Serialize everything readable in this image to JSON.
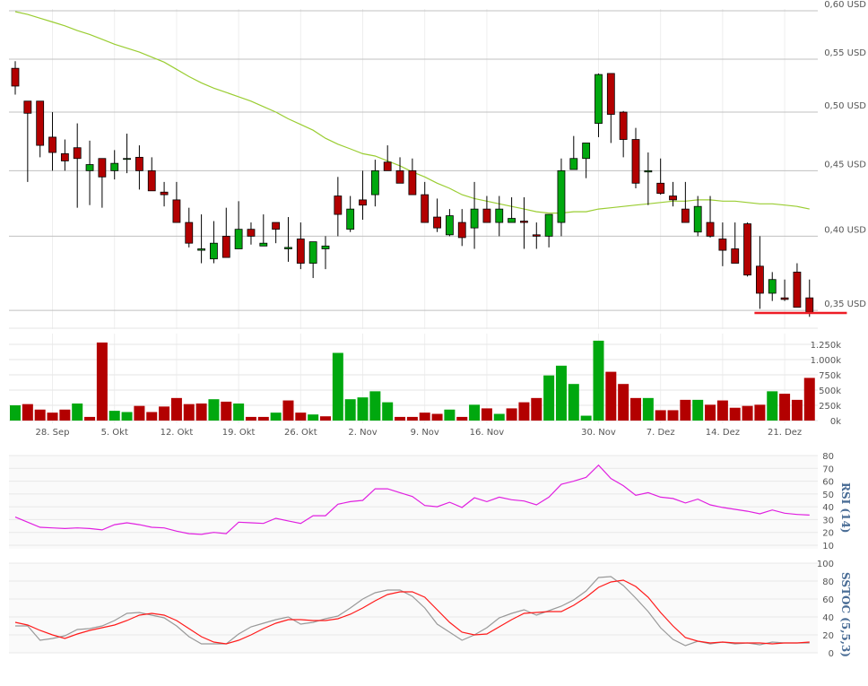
{
  "chart_data": [
    {
      "type": "candlestick",
      "panel": "price",
      "y_scale": "log",
      "ylim": [
        0.345,
        0.6
      ],
      "y_ticks": [
        {
          "value": 0.6,
          "label": "0,60 USD"
        },
        {
          "value": 0.55,
          "label": "0,55 USD"
        },
        {
          "value": 0.5,
          "label": "0,50 USD"
        },
        {
          "value": 0.45,
          "label": "0,45 USD"
        },
        {
          "value": 0.4,
          "label": "0,40 USD"
        },
        {
          "value": 0.35,
          "label": "0,35 USD"
        }
      ],
      "grid": true,
      "up_color": "#00a80f",
      "down_color": "#b30000",
      "ma_color": "#9acd32",
      "support_color": "#ee1c25",
      "support_level": 0.349,
      "support_range": [
        60,
        66
      ],
      "ohlc": [
        [
          0.541,
          0.548,
          0.516,
          0.524
        ],
        [
          0.51,
          0.51,
          0.441,
          0.499
        ],
        [
          0.51,
          0.51,
          0.461,
          0.471
        ],
        [
          0.478,
          0.5,
          0.45,
          0.465
        ],
        [
          0.464,
          0.476,
          0.45,
          0.458
        ],
        [
          0.469,
          0.49,
          0.421,
          0.46
        ],
        [
          0.45,
          0.475,
          0.423,
          0.455
        ],
        [
          0.46,
          0.46,
          0.421,
          0.445
        ],
        [
          0.45,
          0.467,
          0.443,
          0.456
        ],
        [
          0.46,
          0.481,
          0.448,
          0.46
        ],
        [
          0.461,
          0.471,
          0.435,
          0.45
        ],
        [
          0.45,
          0.461,
          0.434,
          0.434
        ],
        [
          0.433,
          0.441,
          0.422,
          0.431
        ],
        [
          0.427,
          0.441,
          0.41,
          0.41
        ],
        [
          0.41,
          0.421,
          0.392,
          0.395
        ],
        [
          0.39,
          0.416,
          0.381,
          0.391
        ],
        [
          0.384,
          0.411,
          0.381,
          0.395
        ],
        [
          0.4,
          0.421,
          0.385,
          0.385
        ],
        [
          0.391,
          0.426,
          0.391,
          0.405
        ],
        [
          0.405,
          0.41,
          0.394,
          0.4
        ],
        [
          0.393,
          0.416,
          0.393,
          0.395
        ],
        [
          0.41,
          0.41,
          0.395,
          0.405
        ],
        [
          0.391,
          0.414,
          0.382,
          0.392
        ],
        [
          0.398,
          0.41,
          0.377,
          0.381
        ],
        [
          0.381,
          0.396,
          0.371,
          0.396
        ],
        [
          0.391,
          0.4,
          0.377,
          0.393
        ],
        [
          0.43,
          0.445,
          0.4,
          0.416
        ],
        [
          0.405,
          0.43,
          0.403,
          0.42
        ],
        [
          0.427,
          0.45,
          0.412,
          0.423
        ],
        [
          0.431,
          0.459,
          0.422,
          0.45
        ],
        [
          0.457,
          0.471,
          0.45,
          0.45
        ],
        [
          0.45,
          0.461,
          0.44,
          0.44
        ],
        [
          0.45,
          0.46,
          0.431,
          0.431
        ],
        [
          0.431,
          0.441,
          0.41,
          0.41
        ],
        [
          0.414,
          0.428,
          0.403,
          0.406
        ],
        [
          0.401,
          0.42,
          0.4,
          0.415
        ],
        [
          0.41,
          0.42,
          0.393,
          0.399
        ],
        [
          0.406,
          0.441,
          0.391,
          0.42
        ],
        [
          0.42,
          0.43,
          0.41,
          0.41
        ],
        [
          0.41,
          0.43,
          0.4,
          0.42
        ],
        [
          0.41,
          0.429,
          0.41,
          0.413
        ],
        [
          0.411,
          0.429,
          0.391,
          0.41
        ],
        [
          0.401,
          0.41,
          0.391,
          0.4
        ],
        [
          0.4,
          0.416,
          0.392,
          0.416
        ],
        [
          0.41,
          0.46,
          0.4,
          0.45
        ],
        [
          0.451,
          0.479,
          0.451,
          0.46
        ],
        [
          0.46,
          0.473,
          0.444,
          0.473
        ],
        [
          0.49,
          0.536,
          0.478,
          0.535
        ],
        [
          0.536,
          0.536,
          0.473,
          0.498
        ],
        [
          0.5,
          0.501,
          0.461,
          0.476
        ],
        [
          0.476,
          0.486,
          0.436,
          0.44
        ],
        [
          0.449,
          0.465,
          0.423,
          0.45
        ],
        [
          0.44,
          0.46,
          0.431,
          0.432
        ],
        [
          0.43,
          0.441,
          0.422,
          0.427
        ],
        [
          0.42,
          0.441,
          0.41,
          0.41
        ],
        [
          0.403,
          0.43,
          0.4,
          0.422
        ],
        [
          0.41,
          0.43,
          0.399,
          0.4
        ],
        [
          0.398,
          0.41,
          0.379,
          0.39
        ],
        [
          0.391,
          0.41,
          0.381,
          0.381
        ],
        [
          0.409,
          0.41,
          0.372,
          0.373
        ],
        [
          0.379,
          0.4,
          0.351,
          0.361
        ],
        [
          0.361,
          0.375,
          0.356,
          0.37
        ],
        [
          0.358,
          0.37,
          0.356,
          0.357
        ],
        [
          0.375,
          0.381,
          0.352,
          0.352
        ],
        [
          0.358,
          0.37,
          0.346,
          0.349
        ]
      ],
      "moving_average": [
        0.599,
        0.596,
        0.592,
        0.588,
        0.584,
        0.579,
        0.575,
        0.57,
        0.565,
        0.561,
        0.557,
        0.552,
        0.547,
        0.54,
        0.533,
        0.527,
        0.522,
        0.518,
        0.514,
        0.51,
        0.505,
        0.5,
        0.494,
        0.489,
        0.484,
        0.477,
        0.472,
        0.468,
        0.464,
        0.462,
        0.458,
        0.454,
        0.449,
        0.445,
        0.44,
        0.436,
        0.431,
        0.428,
        0.426,
        0.424,
        0.422,
        0.42,
        0.418,
        0.417,
        0.417,
        0.418,
        0.418,
        0.42,
        0.421,
        0.422,
        0.423,
        0.424,
        0.425,
        0.426,
        0.426,
        0.427,
        0.427,
        0.426,
        0.426,
        0.425,
        0.424,
        0.424,
        0.423,
        0.422,
        0.42
      ]
    },
    {
      "type": "bar",
      "panel": "volume",
      "ylim": [
        0,
        1250
      ],
      "y_ticks": [
        {
          "value": 1250,
          "label": "1.250k"
        },
        {
          "value": 1000,
          "label": "1.000k"
        },
        {
          "value": 750,
          "label": "750k"
        },
        {
          "value": 500,
          "label": "500k"
        },
        {
          "value": 250,
          "label": "250k"
        },
        {
          "value": 0,
          "label": "0k"
        }
      ],
      "x_ticks": [
        {
          "index": 3,
          "label": "28. Sep"
        },
        {
          "index": 8,
          "label": "5. Okt"
        },
        {
          "index": 13,
          "label": "12. Okt"
        },
        {
          "index": 18,
          "label": "19. Okt"
        },
        {
          "index": 23,
          "label": "26. Okt"
        },
        {
          "index": 28,
          "label": "2. Nov"
        },
        {
          "index": 33,
          "label": "9. Nov"
        },
        {
          "index": 38,
          "label": "16. Nov"
        },
        {
          "index": 47,
          "label": "30. Nov"
        },
        {
          "index": 52,
          "label": "7. Dez"
        },
        {
          "index": 57,
          "label": "14. Dez"
        },
        {
          "index": 62,
          "label": "21. Dez"
        }
      ],
      "values": [
        250,
        270,
        180,
        130,
        180,
        280,
        60,
        1280,
        160,
        140,
        240,
        140,
        230,
        370,
        270,
        280,
        350,
        310,
        280,
        60,
        60,
        130,
        330,
        130,
        100,
        70,
        1110,
        350,
        380,
        480,
        300,
        60,
        60,
        130,
        110,
        180,
        60,
        260,
        200,
        110,
        200,
        300,
        370,
        740,
        900,
        600,
        80,
        1310,
        800,
        600,
        370,
        370,
        170,
        170,
        340,
        340,
        260,
        330,
        210,
        240,
        260,
        480,
        440,
        340,
        700
      ],
      "directions": [
        "up",
        "down",
        "down",
        "down",
        "down",
        "up",
        "down",
        "down",
        "up",
        "up",
        "down",
        "down",
        "down",
        "down",
        "down",
        "down",
        "up",
        "down",
        "up",
        "down",
        "down",
        "up",
        "down",
        "down",
        "up",
        "down",
        "up",
        "up",
        "up",
        "up",
        "up",
        "down",
        "down",
        "down",
        "down",
        "up",
        "down",
        "up",
        "down",
        "up",
        "down",
        "down",
        "down",
        "up",
        "up",
        "up",
        "up",
        "up",
        "down",
        "down",
        "down",
        "up",
        "down",
        "down",
        "down",
        "up",
        "down",
        "down",
        "down",
        "down",
        "down",
        "up",
        "down",
        "down",
        "down"
      ]
    },
    {
      "type": "line",
      "panel": "rsi",
      "ylabel": "RSI (14)",
      "ylim": [
        10,
        80
      ],
      "y_ticks": [
        80,
        70,
        60,
        50,
        40,
        30,
        20,
        10
      ],
      "color": "#e020e0",
      "values": [
        32,
        28,
        24,
        23.5,
        23,
        23.5,
        23,
        22,
        26,
        27.5,
        26,
        24,
        23.5,
        21,
        19,
        18.5,
        20,
        19,
        28,
        27.5,
        27,
        31,
        29,
        27,
        33,
        33,
        42,
        44,
        45,
        54,
        54,
        51,
        48,
        41,
        40,
        43.5,
        39.5,
        47,
        44,
        47.5,
        45.5,
        44.5,
        41.5,
        47.5,
        57.5,
        60,
        63,
        72.5,
        62,
        56.5,
        49,
        51,
        47.5,
        46.5,
        43,
        46,
        41.5,
        39.5,
        38,
        36.5,
        34.5,
        37.5,
        35,
        34,
        33.5
      ]
    },
    {
      "type": "line",
      "panel": "sstoc",
      "ylabel": "SSTOC (5,5,3)",
      "ylim": [
        0,
        100
      ],
      "y_ticks": [
        100,
        80,
        60,
        40,
        20,
        0
      ],
      "series": [
        {
          "color": "#999999",
          "values": [
            30,
            30,
            14,
            16,
            19,
            26,
            27,
            30,
            36,
            44,
            45,
            42,
            39,
            30,
            18,
            10,
            10,
            10,
            21,
            29,
            33,
            37,
            40,
            32,
            34,
            38,
            41,
            50,
            60,
            67,
            70,
            70,
            63,
            50,
            32,
            23,
            14,
            20,
            28,
            39,
            44,
            48,
            42,
            47,
            52,
            59,
            69,
            84,
            85,
            75,
            61,
            46,
            28,
            15,
            8,
            13,
            10,
            12,
            10,
            11,
            9,
            12,
            11,
            11,
            11
          ]
        },
        {
          "color": "#ff1a1a",
          "values": [
            34,
            31,
            25,
            20,
            16,
            21,
            25,
            28,
            31,
            36,
            42,
            44,
            42,
            36,
            27,
            18,
            12,
            10,
            14,
            20,
            27,
            33,
            37,
            37,
            36,
            36,
            38,
            43,
            50,
            58,
            65,
            68,
            68,
            62,
            48,
            34,
            23,
            20,
            21,
            29,
            37,
            44,
            45,
            46,
            46,
            53,
            62,
            73,
            79,
            81,
            74,
            62,
            45,
            30,
            17,
            13,
            11,
            12,
            11,
            11,
            11,
            10,
            11,
            11,
            12
          ]
        }
      ]
    }
  ]
}
